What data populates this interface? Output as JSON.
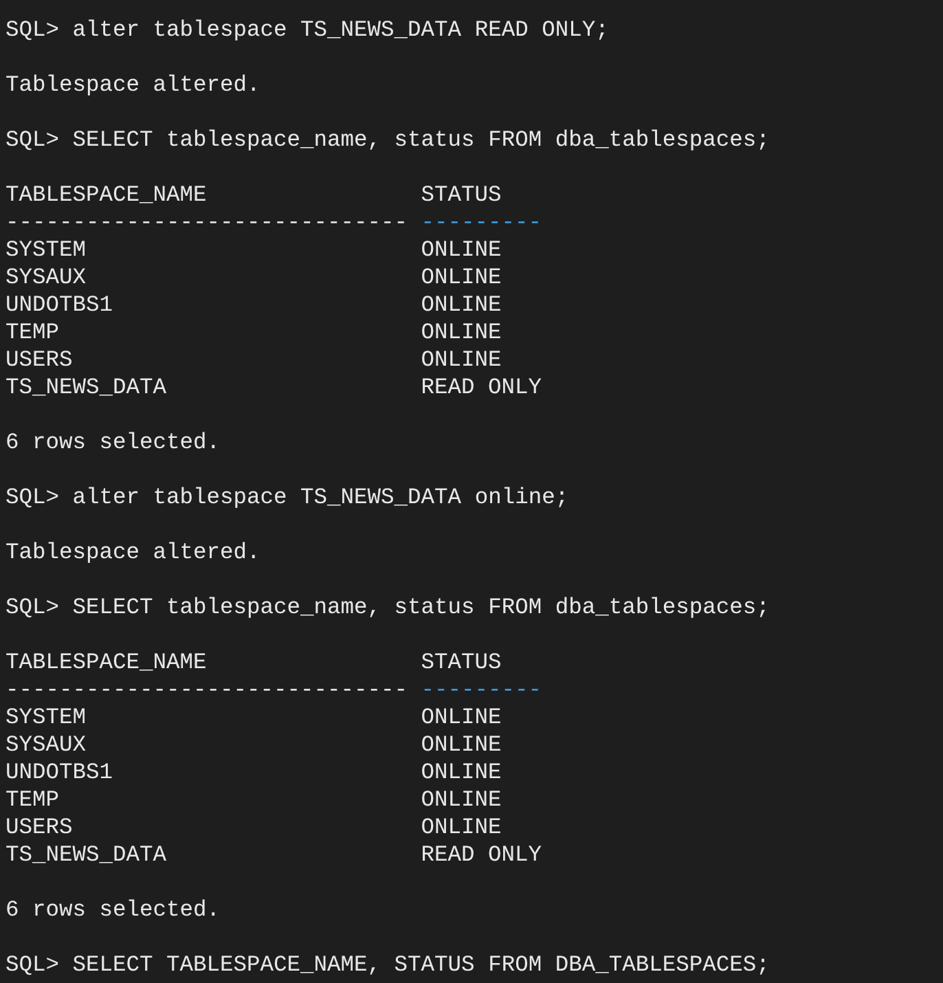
{
  "terminal": {
    "blocks": [
      {
        "kind": "command",
        "prompt": "SQL>",
        "text": "alter tablespace TS_NEWS_DATA READ ONLY;"
      },
      {
        "kind": "message",
        "text": "Tablespace altered."
      },
      {
        "kind": "command",
        "prompt": "SQL>",
        "text": "SELECT tablespace_name, status FROM dba_tablespaces;"
      },
      {
        "kind": "table",
        "columns": [
          "TABLESPACE_NAME",
          "STATUS"
        ],
        "rulers": [
          {
            "text": "------------------------------",
            "color": "#e8e8e8"
          },
          {
            "text": "---------",
            "color": "#3aa0e6"
          }
        ],
        "rows": [
          [
            "SYSTEM",
            "ONLINE"
          ],
          [
            "SYSAUX",
            "ONLINE"
          ],
          [
            "UNDOTBS1",
            "ONLINE"
          ],
          [
            "TEMP",
            "ONLINE"
          ],
          [
            "USERS",
            "ONLINE"
          ],
          [
            "TS_NEWS_DATA",
            "READ ONLY"
          ]
        ]
      },
      {
        "kind": "message",
        "text": "6 rows selected."
      },
      {
        "kind": "command",
        "prompt": "SQL>",
        "text": "alter tablespace TS_NEWS_DATA online;"
      },
      {
        "kind": "message",
        "text": "Tablespace altered."
      },
      {
        "kind": "command",
        "prompt": "SQL>",
        "text": "SELECT tablespace_name, status FROM dba_tablespaces;"
      },
      {
        "kind": "table",
        "columns": [
          "TABLESPACE_NAME",
          "STATUS"
        ],
        "rulers": [
          {
            "text": "------------------------------",
            "color": "#e8e8e8"
          },
          {
            "text": "---------",
            "color": "#3aa0e6"
          }
        ],
        "rows": [
          [
            "SYSTEM",
            "ONLINE"
          ],
          [
            "SYSAUX",
            "ONLINE"
          ],
          [
            "UNDOTBS1",
            "ONLINE"
          ],
          [
            "TEMP",
            "ONLINE"
          ],
          [
            "USERS",
            "ONLINE"
          ],
          [
            "TS_NEWS_DATA",
            "READ ONLY"
          ]
        ]
      },
      {
        "kind": "message",
        "text": "6 rows selected."
      },
      {
        "kind": "command",
        "prompt": "SQL>",
        "text": "SELECT TABLESPACE_NAME, STATUS FROM DBA_TABLESPACES;"
      }
    ]
  }
}
